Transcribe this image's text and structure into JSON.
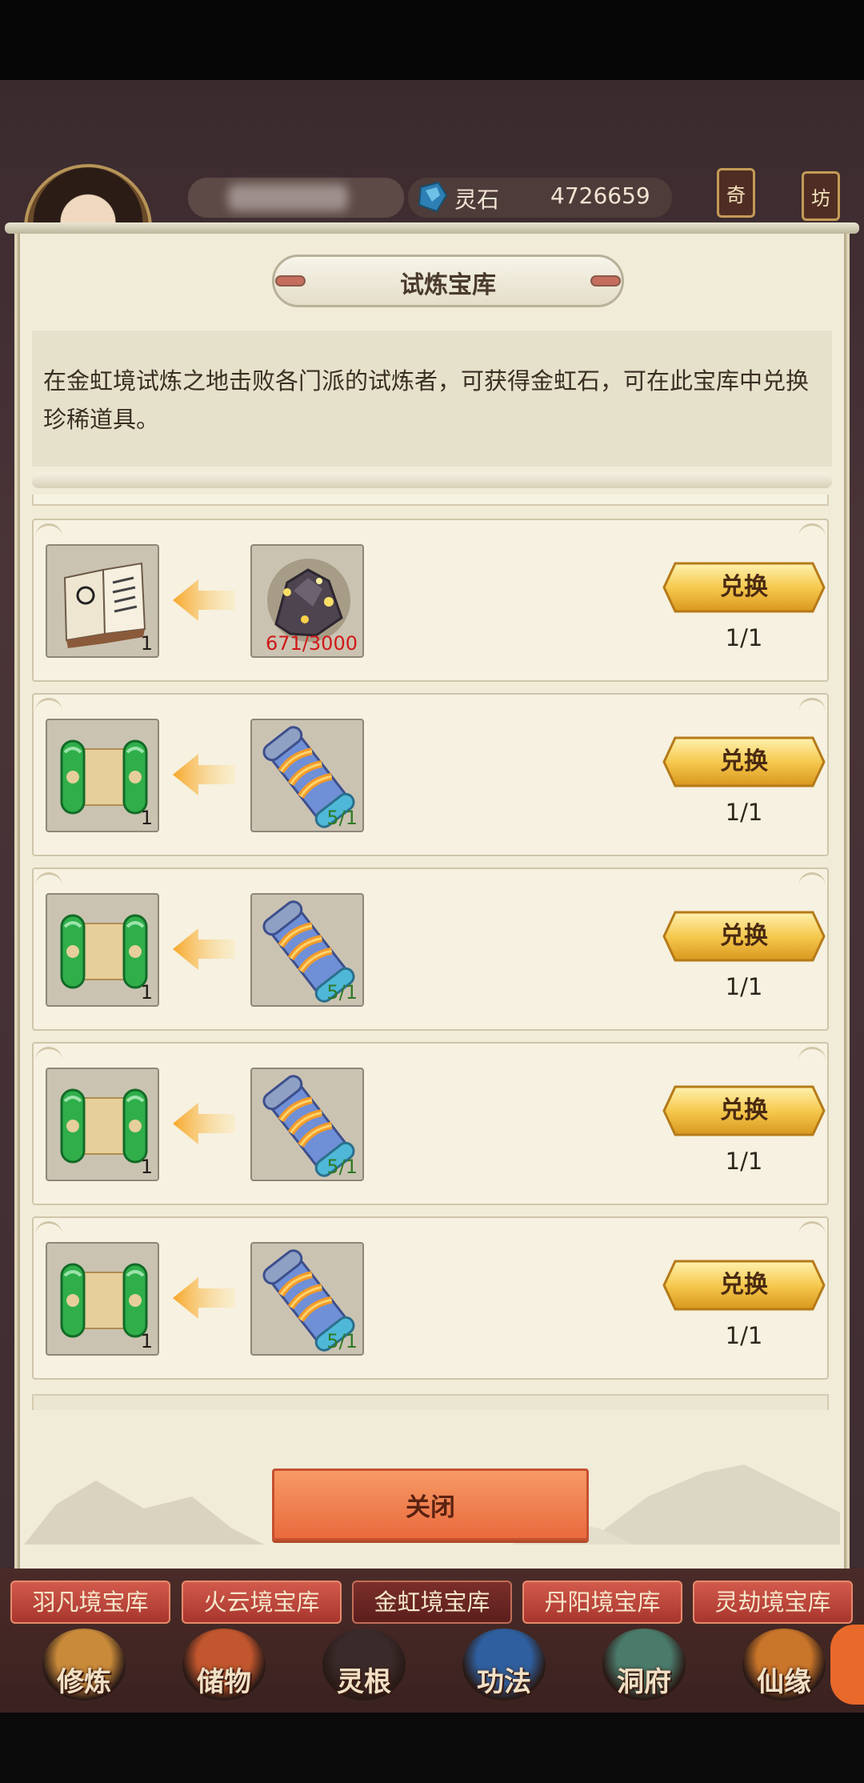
{
  "hud": {
    "stone_label": "灵石",
    "stone_value": "4726659",
    "tag_qi": "奇",
    "tag_fang": "坊"
  },
  "panel": {
    "title": "试炼宝库",
    "description": "在金虹境试炼之地击败各门派的试炼者，可获得金虹石，可在此宝库中兑换珍稀道具。",
    "close_label": "关闭"
  },
  "rows": [
    {
      "reward_icon": "book-icon",
      "reward_count": "1",
      "cost_icon": "golden-ore-icon",
      "cost_text": "671/3000",
      "cost_color": "#d01818",
      "button": "兑换",
      "limit": "1/1"
    },
    {
      "reward_icon": "green-scroll-icon",
      "reward_count": "1",
      "cost_icon": "blue-scroll-icon",
      "cost_text": "5/1",
      "cost_color": "#2f7a25",
      "button": "兑换",
      "limit": "1/1"
    },
    {
      "reward_icon": "green-scroll-icon",
      "reward_count": "1",
      "cost_icon": "blue-scroll-icon",
      "cost_text": "5/1",
      "cost_color": "#2f7a25",
      "button": "兑换",
      "limit": "1/1"
    },
    {
      "reward_icon": "green-scroll-icon",
      "reward_count": "1",
      "cost_icon": "blue-scroll-icon",
      "cost_text": "5/1",
      "cost_color": "#2f7a25",
      "button": "兑换",
      "limit": "1/1"
    },
    {
      "reward_icon": "green-scroll-icon",
      "reward_count": "1",
      "cost_icon": "blue-scroll-icon",
      "cost_text": "5/1",
      "cost_color": "#2f7a25",
      "button": "兑换",
      "limit": "1/1"
    }
  ],
  "tabs": [
    {
      "label": "羽凡境宝库",
      "active": false
    },
    {
      "label": "火云境宝库",
      "active": false
    },
    {
      "label": "金虹境宝库",
      "active": true
    },
    {
      "label": "丹阳境宝库",
      "active": false
    },
    {
      "label": "灵劫境宝库",
      "active": false
    }
  ],
  "nav": [
    {
      "label": "修炼"
    },
    {
      "label": "储物"
    },
    {
      "label": "灵根"
    },
    {
      "label": "功法"
    },
    {
      "label": "洞府"
    },
    {
      "label": "仙缘"
    }
  ]
}
